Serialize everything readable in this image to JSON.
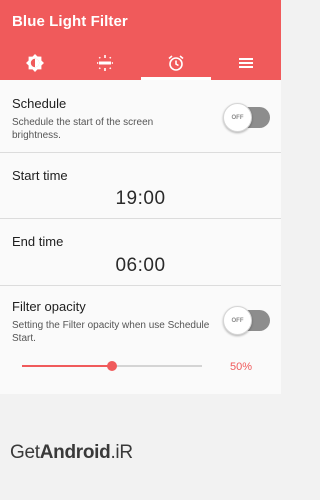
{
  "app": {
    "title": "Blue Light Filter",
    "accent_color": "#f05a5b"
  },
  "tabs": [
    {
      "icon": "brightness-icon",
      "active": false
    },
    {
      "icon": "screen-dim-icon",
      "active": false
    },
    {
      "icon": "alarm-clock-icon",
      "active": true
    },
    {
      "icon": "menu-icon",
      "active": false
    }
  ],
  "schedule": {
    "title": "Schedule",
    "description": "Schedule the start of the screen brightness.",
    "toggle_label": "OFF"
  },
  "start_time": {
    "title": "Start time",
    "value": "19:00"
  },
  "end_time": {
    "title": "End time",
    "value": "06:00"
  },
  "filter_opacity": {
    "title": "Filter opacity",
    "description": "Setting the Filter opacity when use Schedule Start.",
    "toggle_label": "OFF",
    "value_percent": 50,
    "value_label": "50%"
  },
  "watermark": {
    "part1": "Get",
    "part2": "Android",
    "part3": ".iR"
  }
}
